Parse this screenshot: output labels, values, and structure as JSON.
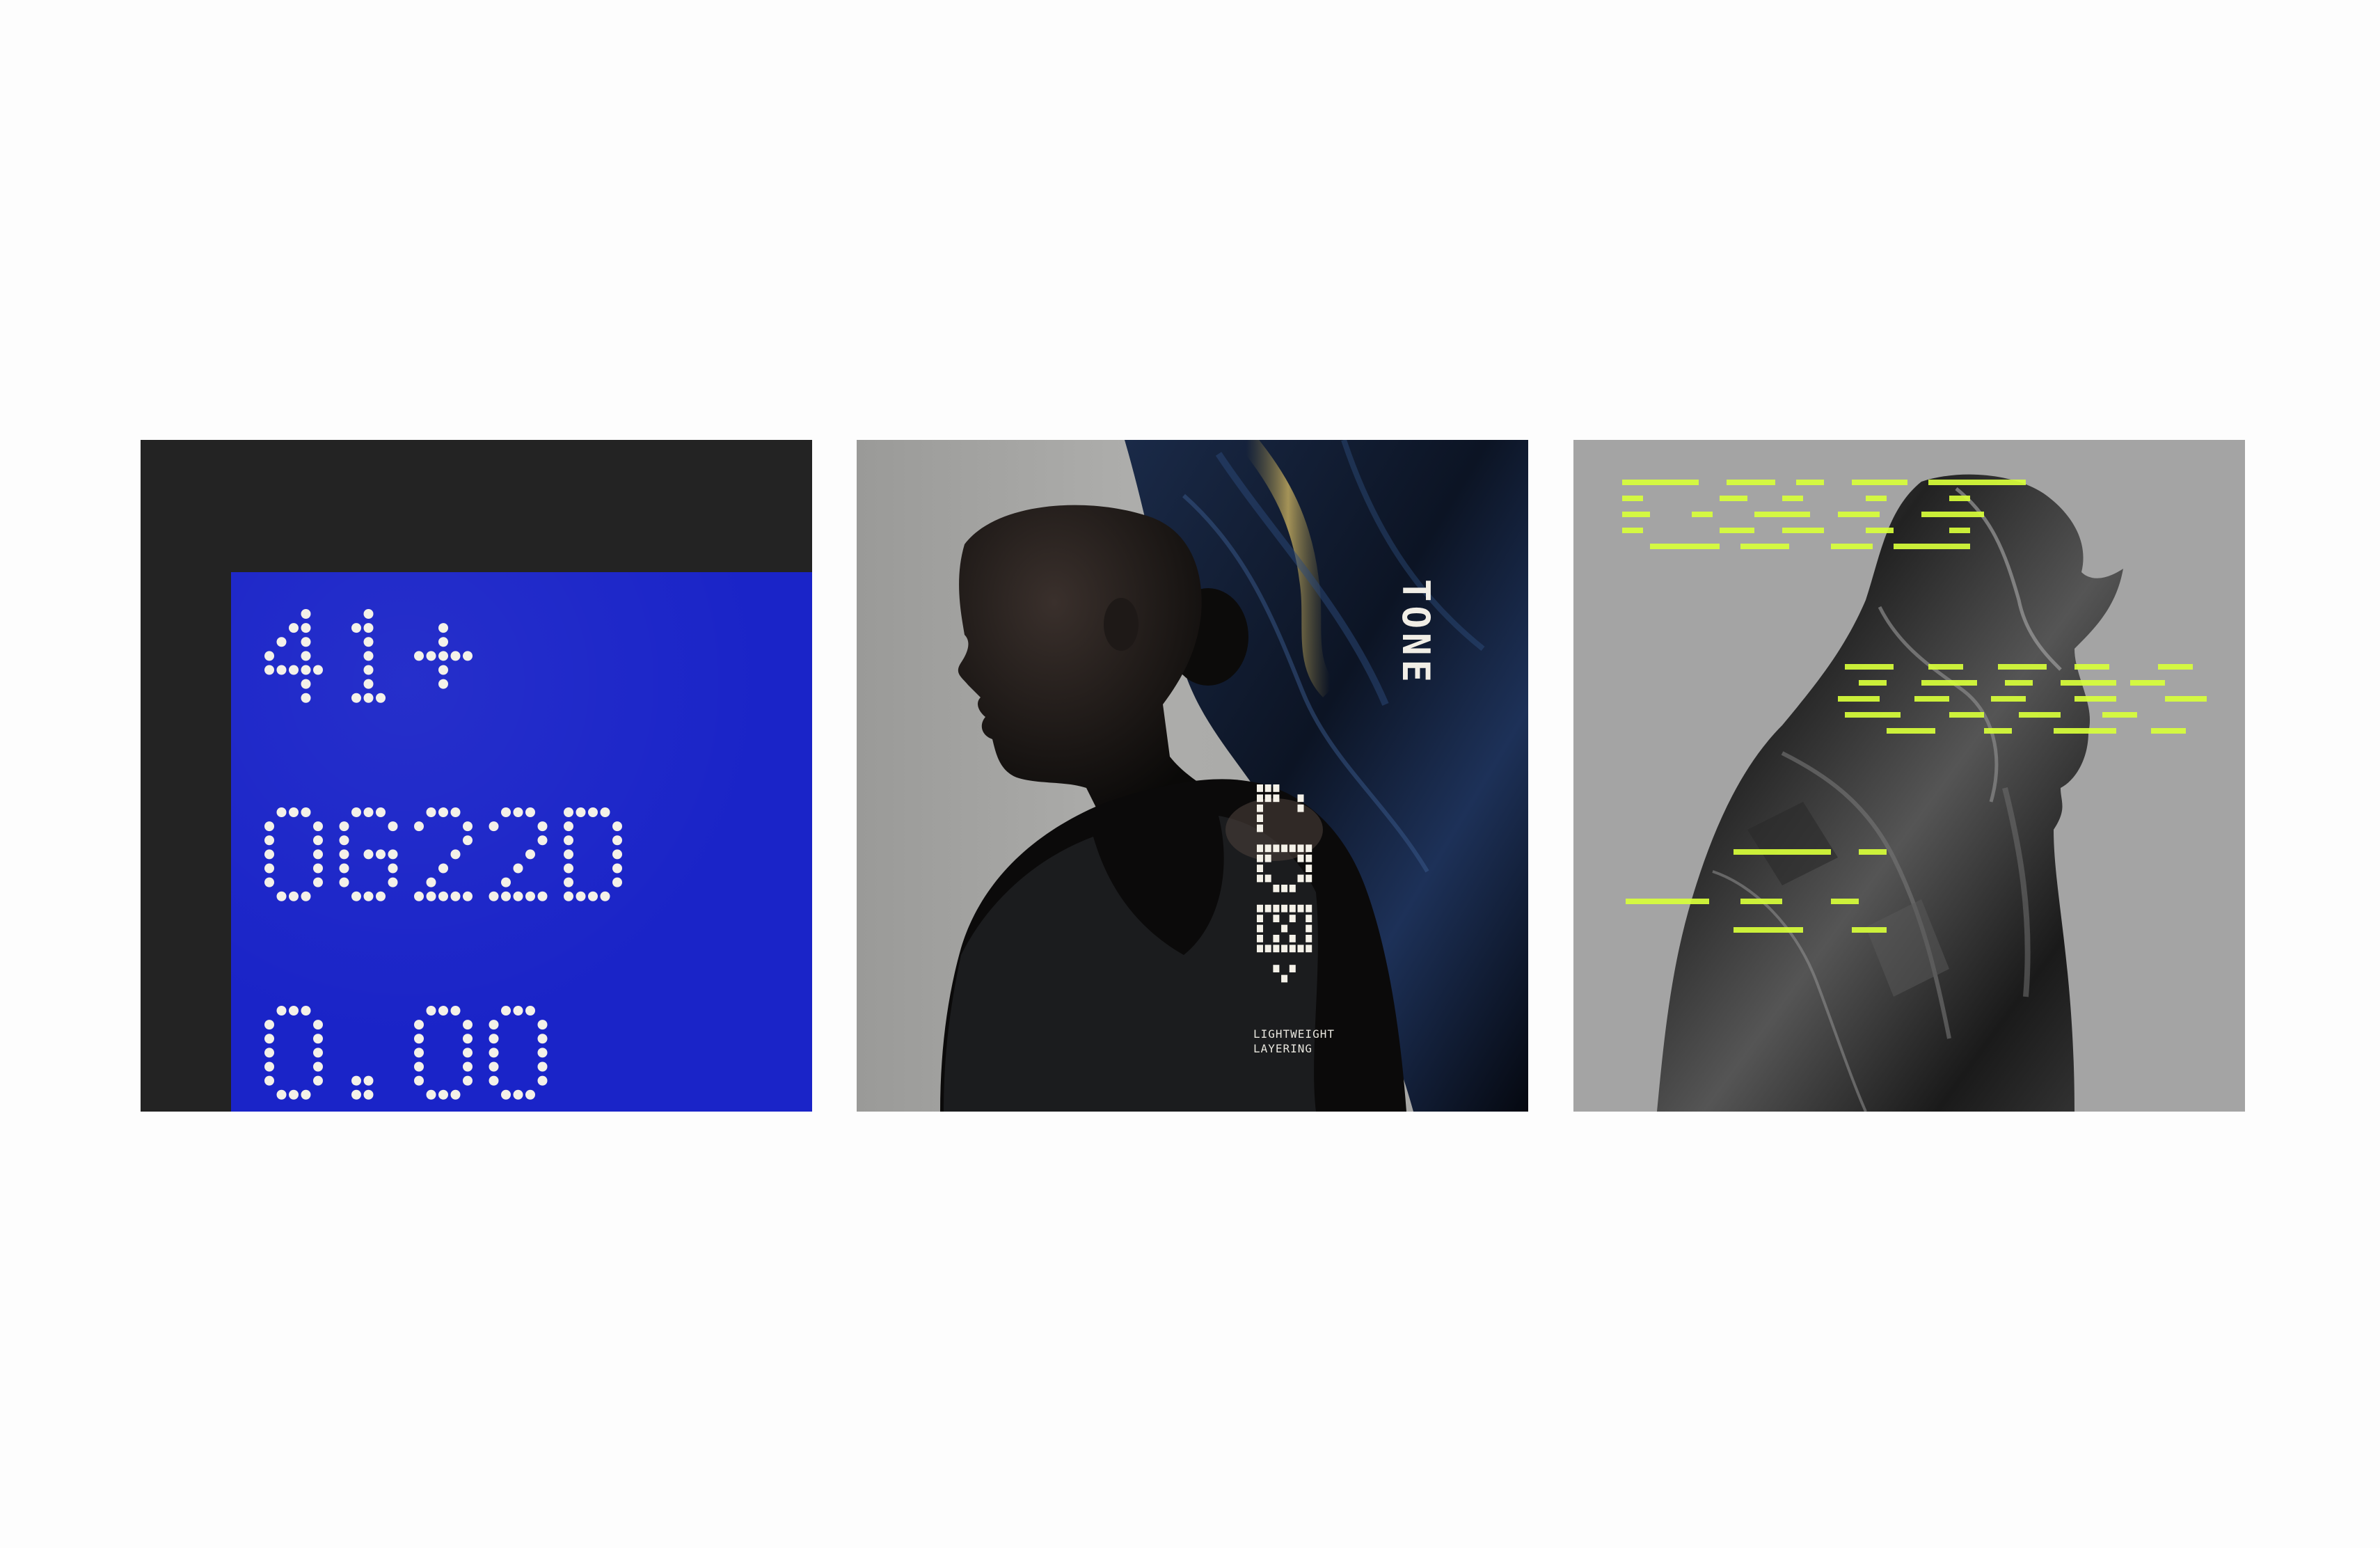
{
  "panels": [
    {
      "label": "blue-dot-type-poster",
      "lines": [
        "41+",
        "0G22D",
        "0.00"
      ]
    },
    {
      "label": "athlete-poster",
      "vertical_word": "TONE",
      "caption": "LIGHTWEIGHT\nLAYERING"
    },
    {
      "label": "jacket-poster"
    }
  ],
  "colors": {
    "card1_frame": "#232323",
    "card1_blue": "#1a24c8",
    "dot": "#f4f1e8",
    "card2_bg": "#a2a2a0",
    "card3_bg": "#a4a4a4",
    "neon": "#d8ff3a"
  }
}
